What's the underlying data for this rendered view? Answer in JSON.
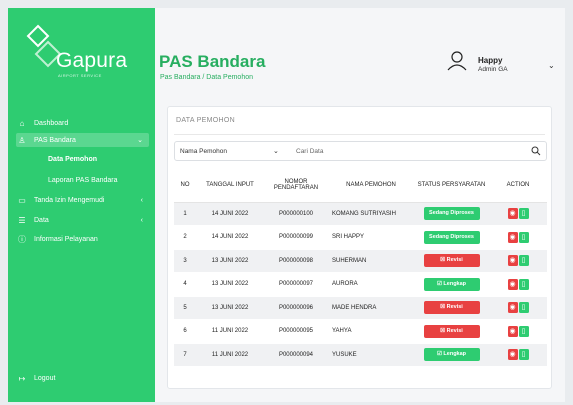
{
  "brand": {
    "name": "Gapura",
    "tagline": "AIRPORT SERVICE"
  },
  "sidebar": {
    "items": [
      {
        "label": "Dashboard",
        "icon": "home-icon"
      },
      {
        "label": "PAS Bandara",
        "icon": "user-icon",
        "active": true
      },
      {
        "label": "Tanda Izin Mengemudi",
        "icon": "card-icon"
      },
      {
        "label": "Data",
        "icon": "database-icon"
      },
      {
        "label": "Informasi Pelayanan",
        "icon": "info-icon"
      }
    ],
    "subitems": [
      "Data Pemohon",
      "Laporan PAS Bandara"
    ],
    "logout": "Logout"
  },
  "header": {
    "title": "PAS Bandara",
    "breadcrumb": "Pas Bandara / Data Pemohon"
  },
  "user": {
    "name": "Happy",
    "role": "Admin GA"
  },
  "card": {
    "title": "DATA PEMOHON"
  },
  "filter": {
    "select_value": "Nama Pemohon",
    "search_placeholder": "Cari Data"
  },
  "table": {
    "headers": [
      "NO",
      "TANGGAL INPUT",
      "NOMOR PENDAFTARAN",
      "NAMA PEMOHON",
      "STATUS PERSYARATAN",
      "ACTION"
    ],
    "rows": [
      {
        "no": "1",
        "date": "14 JUNI 2022",
        "reg": "P000000100",
        "name": "KOMANG SUTRIYASIH",
        "status": "Sedang Diproses",
        "status_type": "process"
      },
      {
        "no": "2",
        "date": "14 JUNI 2022",
        "reg": "P000000099",
        "name": "SRI HAPPY",
        "status": "Sedang Diproses",
        "status_type": "process"
      },
      {
        "no": "3",
        "date": "13 JUNI 2022",
        "reg": "P000000098",
        "name": "SUHERMAN",
        "status": "Revisi",
        "status_type": "revisi"
      },
      {
        "no": "4",
        "date": "13 JUNI 2022",
        "reg": "P000000097",
        "name": "AURORA",
        "status": "Lengkap",
        "status_type": "lengkap"
      },
      {
        "no": "5",
        "date": "13 JUNI 2022",
        "reg": "P000000096",
        "name": "MADE HENDRA",
        "status": "Revisi",
        "status_type": "revisi"
      },
      {
        "no": "6",
        "date": "11 JUNI 2022",
        "reg": "P000000095",
        "name": "YAHYA",
        "status": "Revisi",
        "status_type": "revisi"
      },
      {
        "no": "7",
        "date": "11 JUNI 2022",
        "reg": "P000000094",
        "name": "YUSUKE",
        "status": "Lengkap",
        "status_type": "lengkap"
      }
    ]
  },
  "colors": {
    "primary": "#2ecc71",
    "danger": "#e84141",
    "title": "#27ae60"
  }
}
